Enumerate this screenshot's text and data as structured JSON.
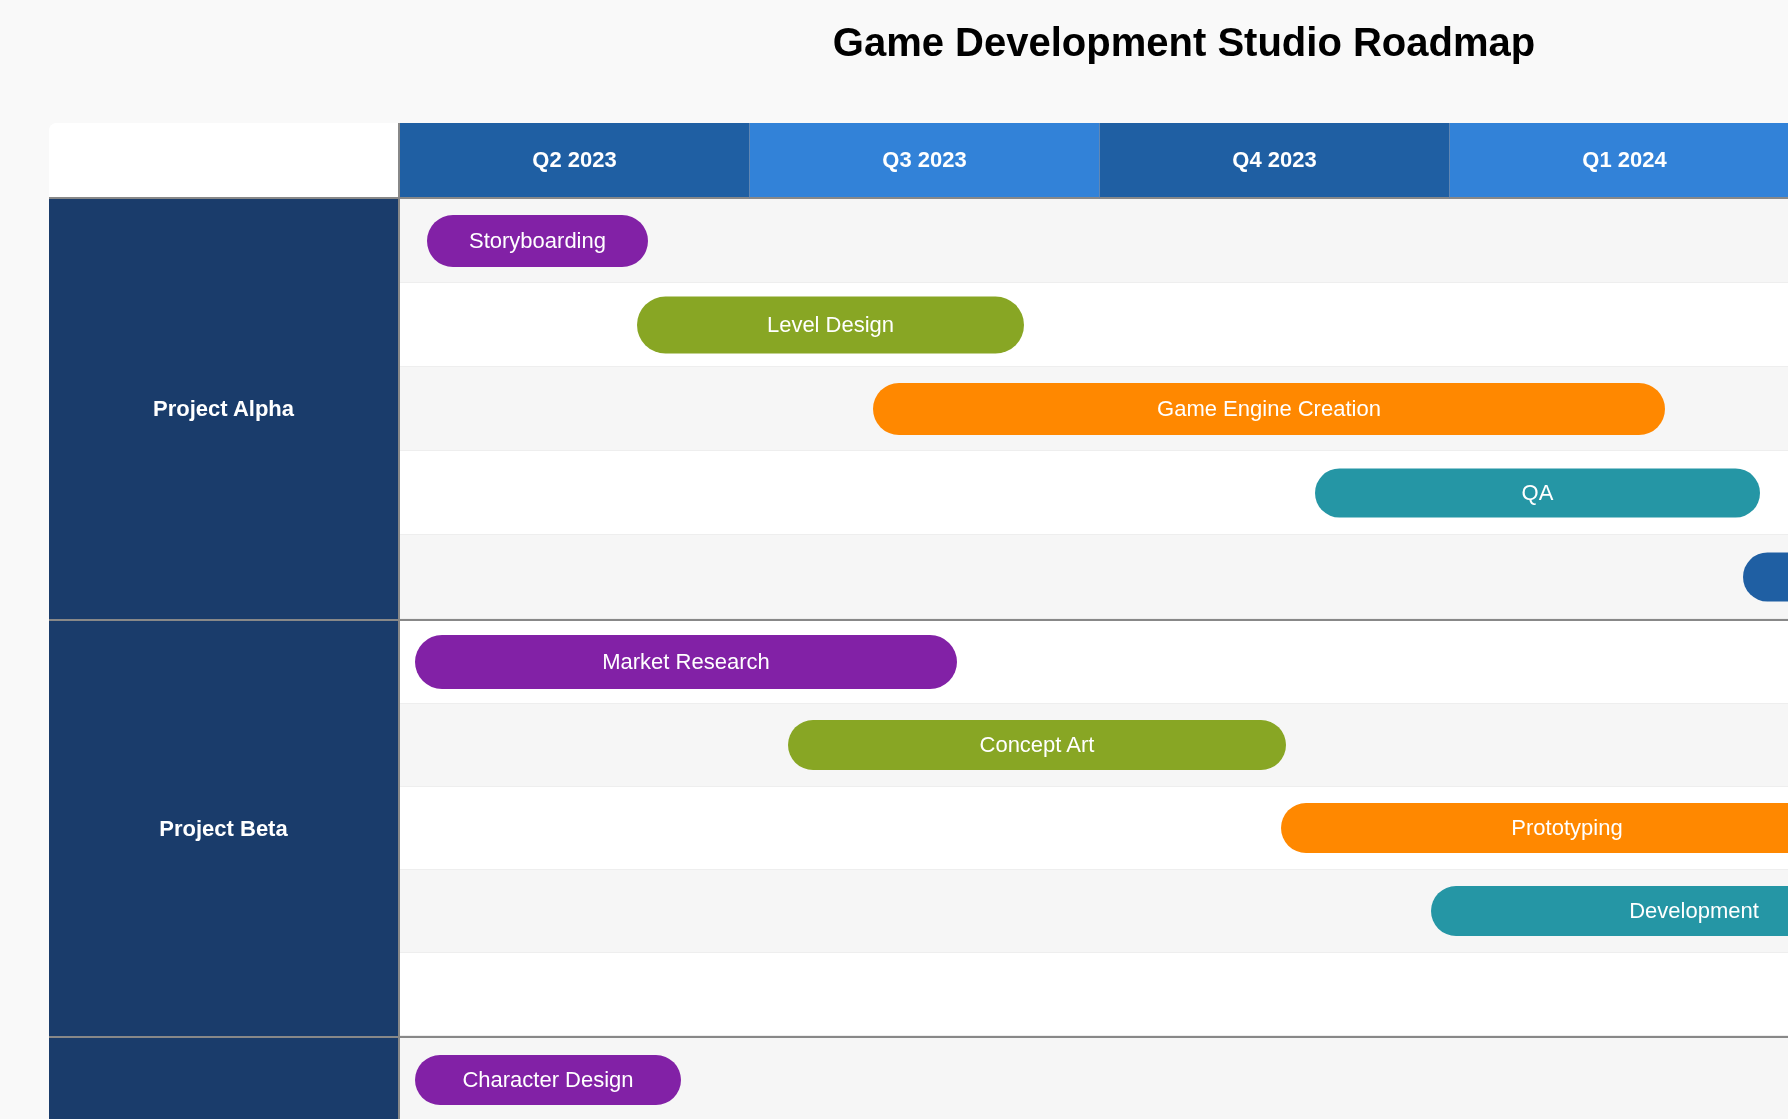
{
  "title": "Game Development Studio Roadmap",
  "quarters": [
    "Q2 2023",
    "Q3 2023",
    "Q4 2023",
    "Q1 2024"
  ],
  "groups": [
    {
      "label": "Project Alpha",
      "rows": [
        {
          "label": "Storyboarding",
          "color": "#8221a6"
        },
        {
          "label": "Level Design",
          "color": "#88a624"
        },
        {
          "label": "Game Engine Creation",
          "color": "#ff8800"
        },
        {
          "label": "QA",
          "color": "#2596a5"
        },
        {
          "color": "#1f5fa3"
        }
      ]
    },
    {
      "label": "Project Beta",
      "rows": [
        {
          "label": "Market Research",
          "color": "#8221a6"
        },
        {
          "label": "Concept Art",
          "color": "#88a624"
        },
        {
          "label": "Prototyping",
          "color": "#ff8800"
        },
        {
          "label": "Development",
          "color": "#2596a5"
        },
        {}
      ]
    },
    {
      "rows": [
        {
          "label": "Character Design",
          "color": "#8221a6"
        }
      ]
    }
  ]
}
